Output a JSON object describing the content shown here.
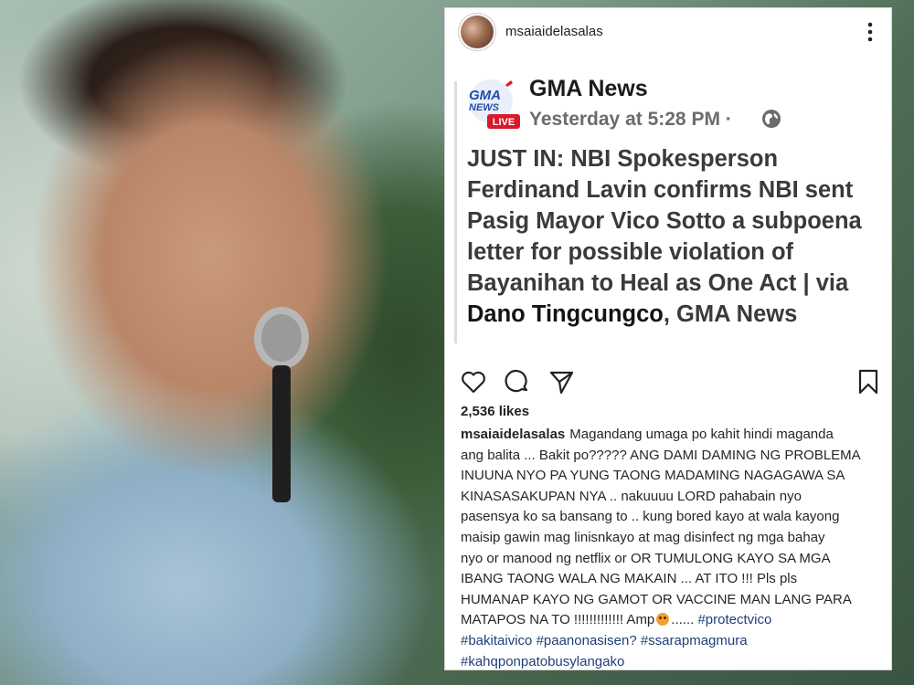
{
  "post": {
    "username": "msaiaidelasalas",
    "source": {
      "name": "GMA News",
      "logo_text_top": "GMA",
      "logo_text_mid": "NEWS",
      "logo_badge": "LIVE",
      "time": "Yesterday at 5:28 PM",
      "separator": "·"
    },
    "headline": {
      "line1": "JUST IN: NBI Spokesperson",
      "line2": "Ferdinand Lavin confirms NBI sent",
      "line3": "Pasig Mayor Vico Sotto a subpoena",
      "line4": "letter for possible violation of",
      "line5": "Bayanihan to Heal as One Act | via",
      "line6_bold": "Dano Tingcungco",
      "line6_rest": ", GMA News"
    },
    "likes": "2,536 likes",
    "caption": {
      "user": "msaiaidelasalas",
      "l1": "Magandang umaga po kahit hindi maganda",
      "l2": "ang balita ... Bakit po????? ANG DAMI DAMING NG PROBLEMA",
      "l3": "INUUNA NYO PA YUNG TAONG MADAMING NAGAGAWA SA",
      "l4": "KINASASAKUPAN NYA .. nakuuuu LORD pahabain nyo",
      "l5": "pasensya ko sa bansang to .. kung bored kayo at wala kayong",
      "l6": "maisip gawin mag linisnkayo at mag disinfect ng mga bahay",
      "l7": "nyo or manood  ng netflix or OR TUMULONG KAYO SA MGA",
      "l8": "IBANG TAONG WALA NG MAKAIN ... AT ITO !!! Pls pls",
      "l9": "HUMANAP KAYO NG GAMOT OR VACCINE MAN LANG PARA",
      "l10": "MATAPOS NA TO !!!!!!!!!!!!! Amp",
      "l10_after": "...... ",
      "tag1": "#protectvico",
      "tag2": "#bakitaivico",
      "tag3": "#paanonasisen?",
      "tag4": "#ssarapmagmura",
      "tag5": "#kahqponpatobusylangako"
    }
  },
  "colors": {
    "hashtag": "#1e3e7a",
    "live_badge": "#d7192a",
    "gma_blue": "#1f4fa8"
  }
}
